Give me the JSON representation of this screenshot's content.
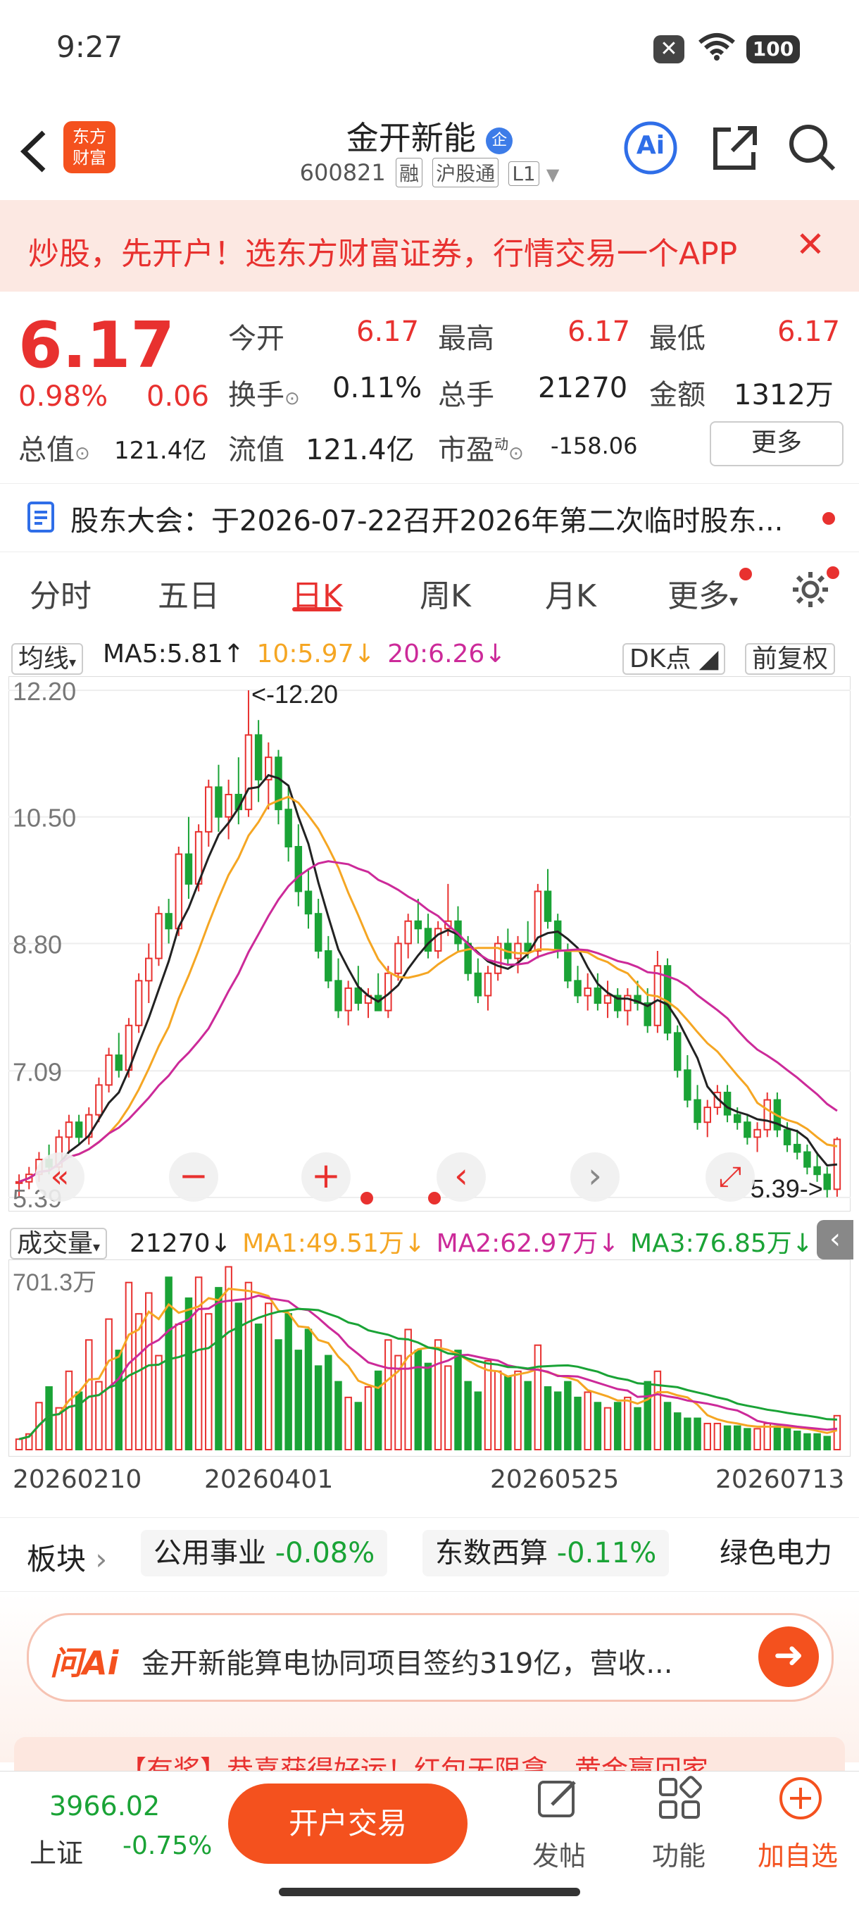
{
  "status_bar": {
    "time": "9:27",
    "battery": "100",
    "notif_icon": "close-icon"
  },
  "header": {
    "logo_line1": "东方",
    "logo_line2": "财富",
    "title": "金开新能",
    "title_badge": "企",
    "code": "600821",
    "tag1": "融",
    "tag2": "沪股通",
    "tag3": "L1",
    "ai_label": "Ai"
  },
  "banner": {
    "text": "炒股，先开户！选东方财富证券，行情交易一个APP"
  },
  "quote": {
    "price": "6.17",
    "change_pct": "0.98%",
    "change": "0.06",
    "open_label": "今开",
    "open": "6.17",
    "high_label": "最高",
    "high": "6.17",
    "low_label": "最低",
    "low": "6.17",
    "turnover_label": "换手",
    "turnover": "0.11%",
    "volume_label": "总手",
    "volume": "21270",
    "amount_label": "金额",
    "amount": "1312万",
    "mktcap_label": "总值",
    "mktcap": "121.4亿",
    "float_label": "流值",
    "float_cap": "121.4亿",
    "pe_label": "市盈",
    "pe_sup": "动",
    "pe": "-158.06",
    "more": "更多"
  },
  "notice": {
    "text": "股东大会：于2026-07-22召开2026年第二次临时股东..."
  },
  "tabs": [
    "分时",
    "五日",
    "日K",
    "周K",
    "月K",
    "更多"
  ],
  "active_tab": 2,
  "kline_legend": {
    "selector": "均线",
    "ma5": "MA5:5.81",
    "ma10": "10:5.97",
    "ma20": "20:6.26",
    "dk": "DK点",
    "adjust": "前复权"
  },
  "chart_data": [
    {
      "type": "candlestick",
      "y_axis_labels": [
        "12.20",
        "10.50",
        "8.80",
        "7.09",
        "5.39"
      ],
      "ylim": [
        5.39,
        12.2
      ],
      "max_annotation": "<-12.20",
      "min_annotation": "5.39->",
      "series": [
        {
          "name": "MA5"
        },
        {
          "name": "10"
        },
        {
          "name": "20"
        }
      ],
      "ohlc": [
        [
          5.6,
          5.7,
          5.4,
          5.6
        ],
        [
          5.6,
          5.8,
          5.5,
          5.7
        ],
        [
          5.7,
          6.0,
          5.6,
          5.9
        ],
        [
          5.9,
          6.1,
          5.7,
          5.8
        ],
        [
          5.8,
          6.3,
          5.7,
          6.2
        ],
        [
          6.2,
          6.5,
          6.0,
          6.4
        ],
        [
          6.4,
          6.5,
          6.1,
          6.2
        ],
        [
          6.2,
          6.6,
          6.1,
          6.5
        ],
        [
          6.5,
          7.0,
          6.4,
          6.9
        ],
        [
          6.9,
          7.4,
          6.8,
          7.3
        ],
        [
          7.3,
          7.6,
          7.0,
          7.1
        ],
        [
          7.1,
          7.8,
          7.0,
          7.7
        ],
        [
          7.7,
          8.4,
          7.6,
          8.3
        ],
        [
          8.3,
          8.8,
          8.0,
          8.6
        ],
        [
          8.6,
          9.3,
          8.5,
          9.2
        ],
        [
          9.2,
          9.4,
          8.8,
          9.0
        ],
        [
          9.0,
          10.1,
          8.9,
          10.0
        ],
        [
          10.0,
          10.5,
          9.4,
          9.6
        ],
        [
          9.6,
          10.4,
          9.5,
          10.3
        ],
        [
          10.3,
          11.0,
          10.1,
          10.9
        ],
        [
          10.9,
          11.2,
          10.3,
          10.5
        ],
        [
          10.5,
          11.0,
          10.2,
          10.8
        ],
        [
          10.8,
          11.3,
          10.4,
          10.6
        ],
        [
          10.6,
          12.2,
          10.5,
          11.6
        ],
        [
          11.6,
          11.8,
          10.7,
          11.0
        ],
        [
          11.0,
          11.5,
          10.6,
          11.3
        ],
        [
          11.3,
          11.4,
          10.4,
          10.6
        ],
        [
          10.6,
          10.9,
          9.9,
          10.1
        ],
        [
          10.1,
          10.4,
          9.3,
          9.5
        ],
        [
          9.5,
          9.8,
          9.0,
          9.2
        ],
        [
          9.2,
          9.4,
          8.6,
          8.7
        ],
        [
          8.7,
          8.9,
          8.2,
          8.3
        ],
        [
          8.3,
          8.6,
          7.8,
          7.9
        ],
        [
          7.9,
          8.3,
          7.7,
          8.2
        ],
        [
          8.2,
          8.5,
          7.9,
          8.0
        ],
        [
          8.0,
          8.2,
          7.8,
          8.1
        ],
        [
          8.1,
          8.4,
          7.9,
          7.9
        ],
        [
          7.9,
          8.5,
          7.8,
          8.4
        ],
        [
          8.4,
          8.9,
          8.3,
          8.8
        ],
        [
          8.8,
          9.2,
          8.6,
          9.1
        ],
        [
          9.1,
          9.4,
          8.8,
          9.0
        ],
        [
          9.0,
          9.2,
          8.6,
          8.7
        ],
        [
          8.7,
          9.1,
          8.6,
          9.0
        ],
        [
          9.0,
          9.6,
          8.9,
          9.1
        ],
        [
          9.1,
          9.3,
          8.7,
          8.8
        ],
        [
          8.8,
          8.9,
          8.3,
          8.4
        ],
        [
          8.4,
          8.6,
          8.0,
          8.1
        ],
        [
          8.1,
          8.5,
          7.9,
          8.4
        ],
        [
          8.4,
          8.9,
          8.3,
          8.8
        ],
        [
          8.8,
          9.0,
          8.5,
          8.6
        ],
        [
          8.6,
          8.9,
          8.4,
          8.8
        ],
        [
          8.8,
          9.1,
          8.6,
          8.7
        ],
        [
          8.7,
          9.6,
          8.6,
          9.5
        ],
        [
          9.5,
          9.8,
          9.0,
          9.1
        ],
        [
          9.1,
          9.2,
          8.6,
          8.7
        ],
        [
          8.7,
          8.8,
          8.2,
          8.3
        ],
        [
          8.3,
          8.5,
          8.0,
          8.1
        ],
        [
          8.1,
          8.4,
          7.9,
          8.2
        ],
        [
          8.2,
          8.4,
          7.9,
          8.0
        ],
        [
          8.0,
          8.3,
          7.8,
          8.1
        ],
        [
          8.1,
          8.2,
          7.8,
          7.9
        ],
        [
          7.9,
          8.2,
          7.7,
          8.1
        ],
        [
          8.1,
          8.3,
          7.9,
          8.0
        ],
        [
          8.0,
          8.2,
          7.6,
          7.7
        ],
        [
          7.7,
          8.7,
          7.6,
          8.5
        ],
        [
          8.5,
          8.6,
          7.5,
          7.6
        ],
        [
          7.6,
          7.7,
          7.0,
          7.1
        ],
        [
          7.1,
          7.3,
          6.6,
          6.7
        ],
        [
          6.7,
          6.9,
          6.3,
          6.4
        ],
        [
          6.4,
          6.7,
          6.2,
          6.6
        ],
        [
          6.6,
          6.9,
          6.5,
          6.8
        ],
        [
          6.8,
          6.9,
          6.4,
          6.5
        ],
        [
          6.5,
          6.6,
          6.3,
          6.4
        ],
        [
          6.4,
          6.5,
          6.1,
          6.2
        ],
        [
          6.2,
          6.4,
          6.0,
          6.3
        ],
        [
          6.3,
          6.8,
          6.2,
          6.7
        ],
        [
          6.7,
          6.8,
          6.2,
          6.3
        ],
        [
          6.3,
          6.4,
          6.0,
          6.1
        ],
        [
          6.1,
          6.3,
          5.9,
          6.0
        ],
        [
          6.0,
          6.1,
          5.7,
          5.8
        ],
        [
          5.8,
          6.0,
          5.6,
          5.7
        ],
        [
          5.7,
          5.8,
          5.39,
          5.5
        ],
        [
          5.5,
          6.2,
          5.4,
          6.17
        ]
      ],
      "x_labels": []
    },
    {
      "type": "bar",
      "title": "成交量",
      "current": "21270",
      "ma1": "MA1:49.51万",
      "ma2": "MA2:62.97万",
      "ma3": "MA3:76.85万",
      "y_axis_labels": [
        "701.3万"
      ],
      "ylim": [
        0,
        701.3
      ],
      "x_labels": [
        "20260210",
        "20260401",
        "20260525",
        "20260713"
      ],
      "series": [
        {
          "name": "MA1"
        },
        {
          "name": "MA2"
        },
        {
          "name": "MA3"
        }
      ],
      "values": [
        40,
        60,
        180,
        240,
        160,
        300,
        220,
        420,
        260,
        500,
        380,
        640,
        520,
        600,
        360,
        660,
        480,
        580,
        660,
        520,
        620,
        700,
        560,
        640,
        480,
        560,
        420,
        520,
        380,
        460,
        320,
        360,
        260,
        200,
        180,
        240,
        300,
        420,
        360,
        460,
        380,
        330,
        420,
        320,
        380,
        260,
        220,
        340,
        300,
        280,
        300,
        260,
        400,
        240,
        220,
        260,
        200,
        220,
        180,
        160,
        180,
        200,
        160,
        260,
        300,
        180,
        140,
        120,
        120,
        100,
        100,
        90,
        90,
        80,
        80,
        100,
        90,
        80,
        70,
        60,
        60,
        50,
        130
      ]
    }
  ],
  "chart_controls": [
    "left-icon-1",
    "minus",
    "plus",
    "left",
    "right",
    "expand"
  ],
  "sectors": {
    "label": "板块",
    "items": [
      {
        "name": "公用事业",
        "change": "-0.08%"
      },
      {
        "name": "东数西算",
        "change": "-0.11%"
      },
      {
        "name": "绿色电力",
        "change": ""
      }
    ]
  },
  "ai_bar": {
    "brand": "问Ai",
    "text": "金开新能算电协同项目签约319亿，营收..."
  },
  "promo": {
    "text": "【有奖】恭喜获得好运！红包无限拿，黄金赢回家"
  },
  "bottom": {
    "index_value": "3966.02",
    "index_name": "上证",
    "index_change": "-0.75%",
    "trade": "开户交易",
    "post": "发帖",
    "func": "功能",
    "watch": "加自选"
  },
  "colors": {
    "up": "#e8312f",
    "down": "#1aa336",
    "ma5": "#222222",
    "ma10": "#f5a623",
    "ma20": "#cc2a99",
    "accent": "#f4511e"
  }
}
